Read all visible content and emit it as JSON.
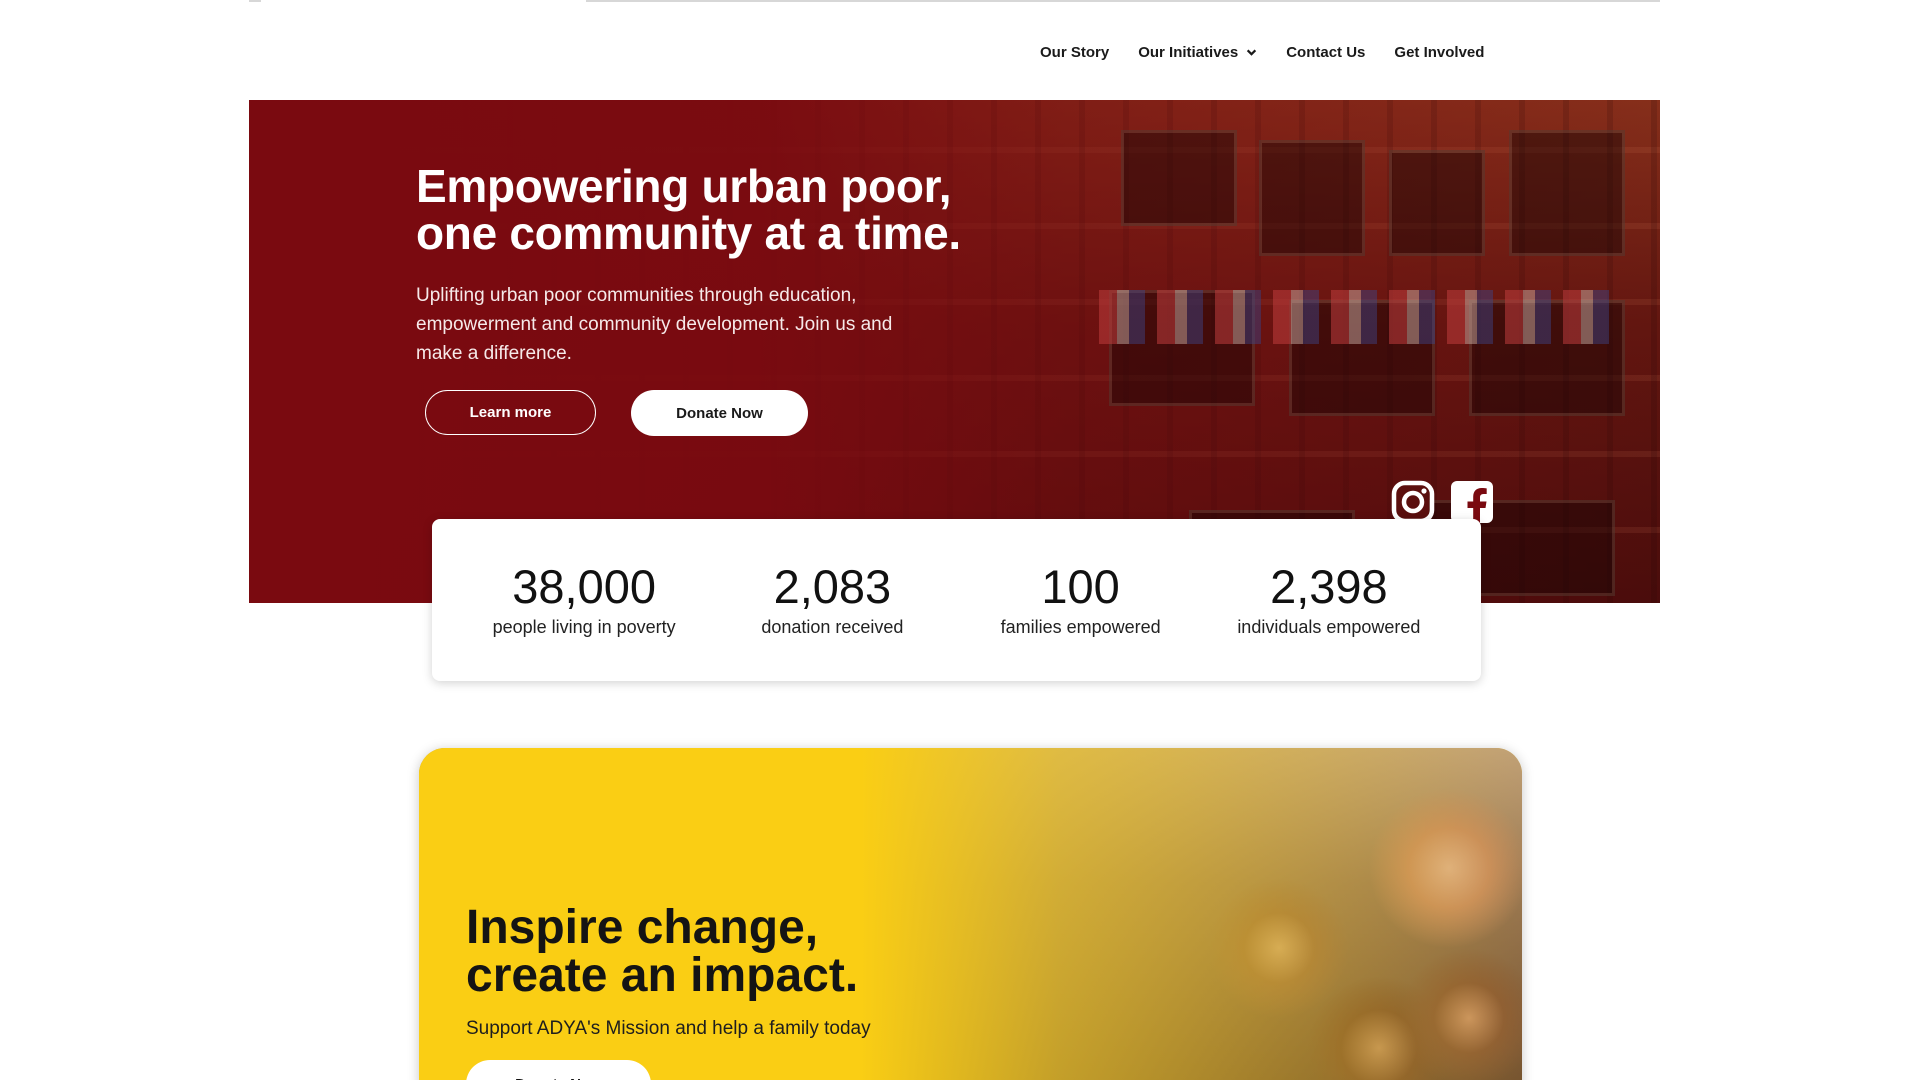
{
  "nav": {
    "items": [
      {
        "label": "Our Story"
      },
      {
        "label": "Our Initiatives",
        "icon": "chevron-down-icon"
      },
      {
        "label": "Contact Us"
      },
      {
        "label": "Get Involved"
      }
    ]
  },
  "hero": {
    "title_line1": "Empowering urban poor,",
    "title_line2": "one community at a time.",
    "subtitle": "Uplifting urban poor communities through education, empowerment and community development. Join us and make a difference.",
    "learn_more_label": "Learn more",
    "donate_label": "Donate Now",
    "social_icons": [
      "instagram-icon",
      "facebook-icon"
    ],
    "accent_color": "#7a0a10"
  },
  "stats": [
    {
      "value": "38,000",
      "label": "people living in poverty"
    },
    {
      "value": "2,083",
      "label": "donation received"
    },
    {
      "value": "100",
      "label": "families empowered"
    },
    {
      "value": "2,398",
      "label": "individuals empowered"
    }
  ],
  "cta": {
    "title_line1": "Inspire change,",
    "title_line2": "create an impact.",
    "subtitle": "Support ADYA's Mission and help a family today",
    "button_label": "Donate Now",
    "accent_color": "#f9cc1e"
  }
}
